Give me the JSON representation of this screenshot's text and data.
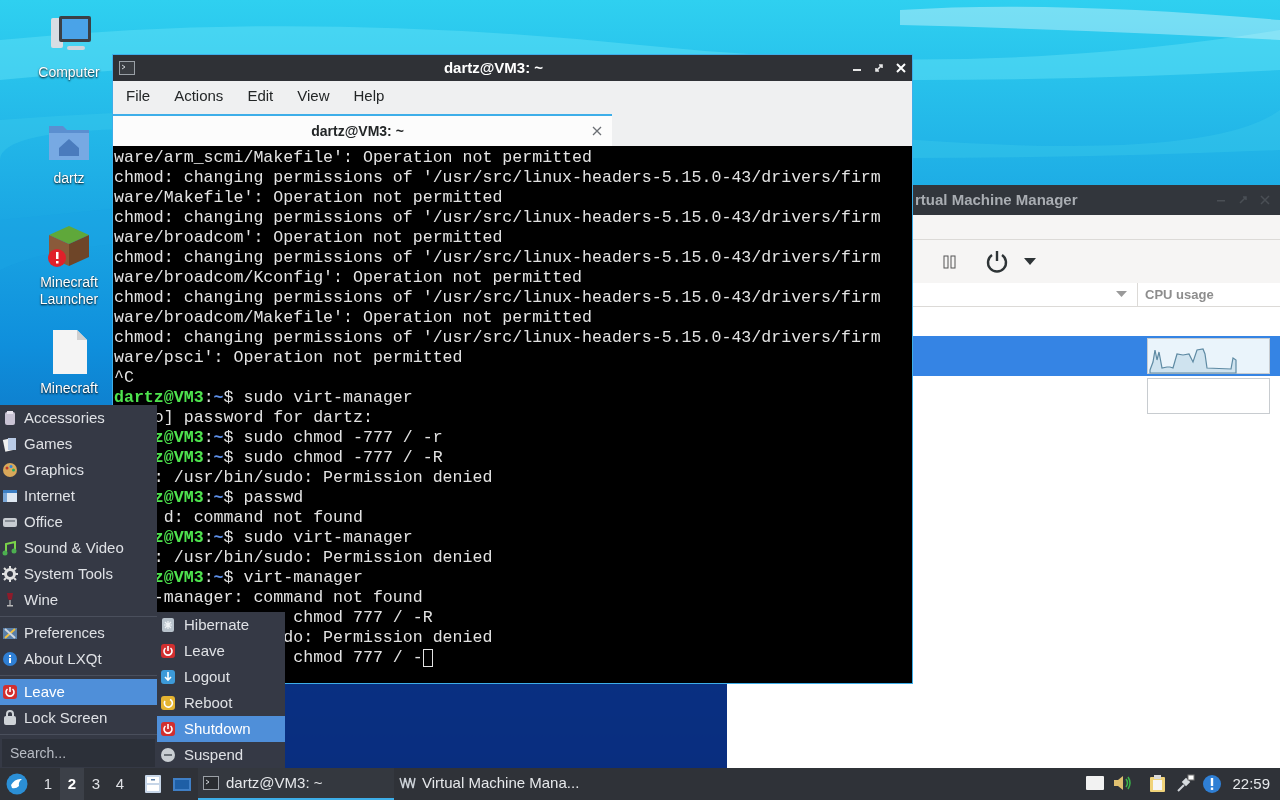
{
  "desktop": {
    "icons": [
      {
        "kind": "computer",
        "label": "Computer"
      },
      {
        "kind": "home",
        "label": "dartz"
      },
      {
        "kind": "block",
        "label": "Minecraft Launcher"
      },
      {
        "kind": "file",
        "label": "Minecraft"
      }
    ]
  },
  "terminal": {
    "title": "dartz@VM3: ~",
    "menu": [
      "File",
      "Actions",
      "Edit",
      "View",
      "Help"
    ],
    "tabs": [
      {
        "label": "dartz@VM3: ~",
        "selected": true
      }
    ],
    "lines": [
      {
        "text": "ware/arm_scmi/Makefile': Operation not permitted"
      },
      {
        "text": "chmod: changing permissions of '/usr/src/linux-headers-5.15.0-43/drivers/firm"
      },
      {
        "text": "ware/Makefile': Operation not permitted"
      },
      {
        "text": "chmod: changing permissions of '/usr/src/linux-headers-5.15.0-43/drivers/firm"
      },
      {
        "text": "ware/broadcom': Operation not permitted"
      },
      {
        "text": "chmod: changing permissions of '/usr/src/linux-headers-5.15.0-43/drivers/firm"
      },
      {
        "text": "ware/broadcom/Kconfig': Operation not permitted"
      },
      {
        "text": "chmod: changing permissions of '/usr/src/linux-headers-5.15.0-43/drivers/firm"
      },
      {
        "text": "ware/broadcom/Makefile': Operation not permitted"
      },
      {
        "text": "chmod: changing permissions of '/usr/src/linux-headers-5.15.0-43/drivers/firm"
      },
      {
        "text": "ware/psci': Operation not permitted"
      },
      {
        "text": "^C"
      },
      {
        "user": "dartz@VM3",
        "sep": ":",
        "path": "~",
        "text": "$ sudo virt-manager"
      },
      {
        "text": "o] password for dartz:"
      },
      {
        "user": "z@VM3",
        "sep": ":",
        "path": "~",
        "text": "$ sudo chmod -777 / -r"
      },
      {
        "user": "z@VM3",
        "sep": ":",
        "path": "~",
        "text": "$ sudo chmod -777 / -R"
      },
      {
        "text": ": /usr/bin/sudo: Permission denied"
      },
      {
        "user": "z@VM3",
        "sep": ":",
        "path": "~",
        "text": "$ passwd"
      },
      {
        "text": "d: command not found"
      },
      {
        "user": "z@VM3",
        "sep": ":",
        "path": "~",
        "text": "$ sudo virt-manager"
      },
      {
        "text": ": /usr/bin/sudo: Permission denied"
      },
      {
        "user": "z@VM3",
        "sep": ":",
        "path": "~",
        "text": "$ virt-manager"
      },
      {
        "text": "-manager: command not found"
      },
      {
        "text": "chmod 777 / -R"
      },
      {
        "text": "do: Permission denied"
      },
      {
        "text": "chmod 777 / -",
        "cursor": true
      }
    ]
  },
  "vmm": {
    "title": "rtual Machine Manager",
    "columns": [
      "CPU usage"
    ],
    "rows": [
      {
        "kind": "vm",
        "selected": true,
        "active": true
      },
      {
        "kind": "vm",
        "selected": false,
        "active": false
      }
    ]
  },
  "start_menu": {
    "groups": [
      [
        "Accessories",
        "Games",
        "Graphics",
        "Internet",
        "Office",
        "Sound & Video",
        "System Tools",
        "Wine"
      ],
      [
        "Preferences",
        "About LXQt"
      ],
      [
        "Leave",
        "Lock Screen"
      ]
    ],
    "highlighted": [
      false,
      false,
      true
    ],
    "search": {
      "placeholder": "Search..."
    },
    "submenu": [
      {
        "label": "Hibernate",
        "selected": false
      },
      {
        "label": "Leave",
        "selected": false
      },
      {
        "label": "Logout",
        "selected": false
      },
      {
        "label": "Reboot",
        "selected": false
      },
      {
        "label": "Shutdown",
        "selected": true
      },
      {
        "label": "Suspend",
        "selected": false
      }
    ]
  },
  "taskbar": {
    "desktops": [
      {
        "label": "1",
        "selected": false
      },
      {
        "label": "2",
        "selected": true
      },
      {
        "label": "3",
        "selected": false
      },
      {
        "label": "4",
        "selected": false
      }
    ],
    "tasks": [
      {
        "kind": "terminal",
        "label": "dartz@VM3: ~",
        "selected": true
      },
      {
        "kind": "vmm",
        "label": "Virtual Machine Mana...",
        "selected": false
      }
    ],
    "clock": "22:59"
  }
}
